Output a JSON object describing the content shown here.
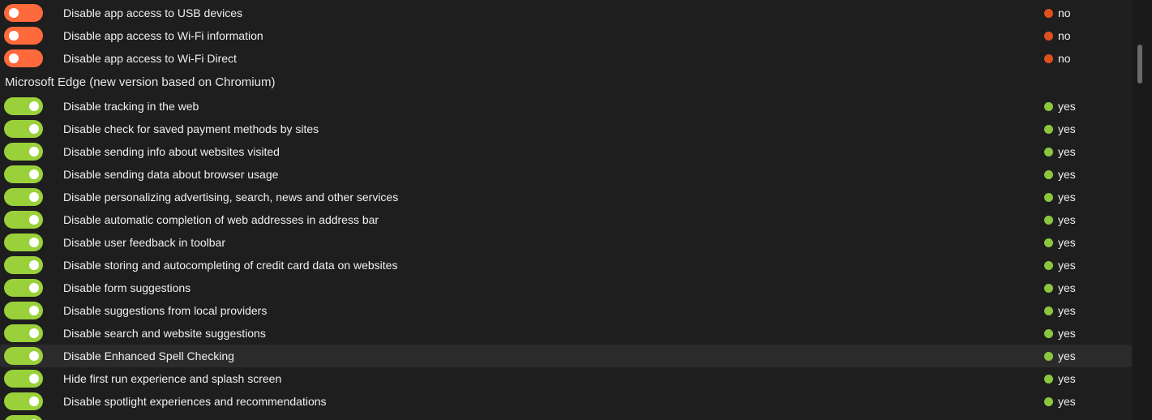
{
  "colors": {
    "background": "#1e1e1e",
    "toggle_off": "#ff6a3d",
    "toggle_on": "#9ad13a",
    "status_no": "#e0501f",
    "status_yes": "#8cc63f"
  },
  "groups": [
    {
      "title": "",
      "items": [
        {
          "label": "Disable app access to USB devices",
          "enabled": false,
          "status": "no"
        },
        {
          "label": "Disable app access to Wi-Fi information",
          "enabled": false,
          "status": "no"
        },
        {
          "label": "Disable app access to Wi-Fi Direct",
          "enabled": false,
          "status": "no"
        }
      ]
    },
    {
      "title": "Microsoft Edge (new version based on Chromium)",
      "items": [
        {
          "label": "Disable tracking in the web",
          "enabled": true,
          "status": "yes"
        },
        {
          "label": "Disable check for saved payment methods by sites",
          "enabled": true,
          "status": "yes"
        },
        {
          "label": "Disable sending info about websites visited",
          "enabled": true,
          "status": "yes"
        },
        {
          "label": "Disable sending data about browser usage",
          "enabled": true,
          "status": "yes"
        },
        {
          "label": "Disable personalizing advertising, search, news and other services",
          "enabled": true,
          "status": "yes"
        },
        {
          "label": "Disable automatic completion of web addresses in address bar",
          "enabled": true,
          "status": "yes"
        },
        {
          "label": "Disable user feedback in toolbar",
          "enabled": true,
          "status": "yes"
        },
        {
          "label": "Disable storing and autocompleting of credit card data on websites",
          "enabled": true,
          "status": "yes"
        },
        {
          "label": "Disable form suggestions",
          "enabled": true,
          "status": "yes"
        },
        {
          "label": "Disable suggestions from local providers",
          "enabled": true,
          "status": "yes"
        },
        {
          "label": "Disable search and website suggestions",
          "enabled": true,
          "status": "yes"
        },
        {
          "label": "Disable Enhanced Spell Checking",
          "enabled": true,
          "status": "yes",
          "highlighted": true
        },
        {
          "label": "Hide first run experience and splash screen",
          "enabled": true,
          "status": "yes"
        },
        {
          "label": "Disable spotlight experiences and recommendations",
          "enabled": true,
          "status": "yes"
        },
        {
          "label": "",
          "enabled": true,
          "status": ""
        }
      ]
    }
  ]
}
